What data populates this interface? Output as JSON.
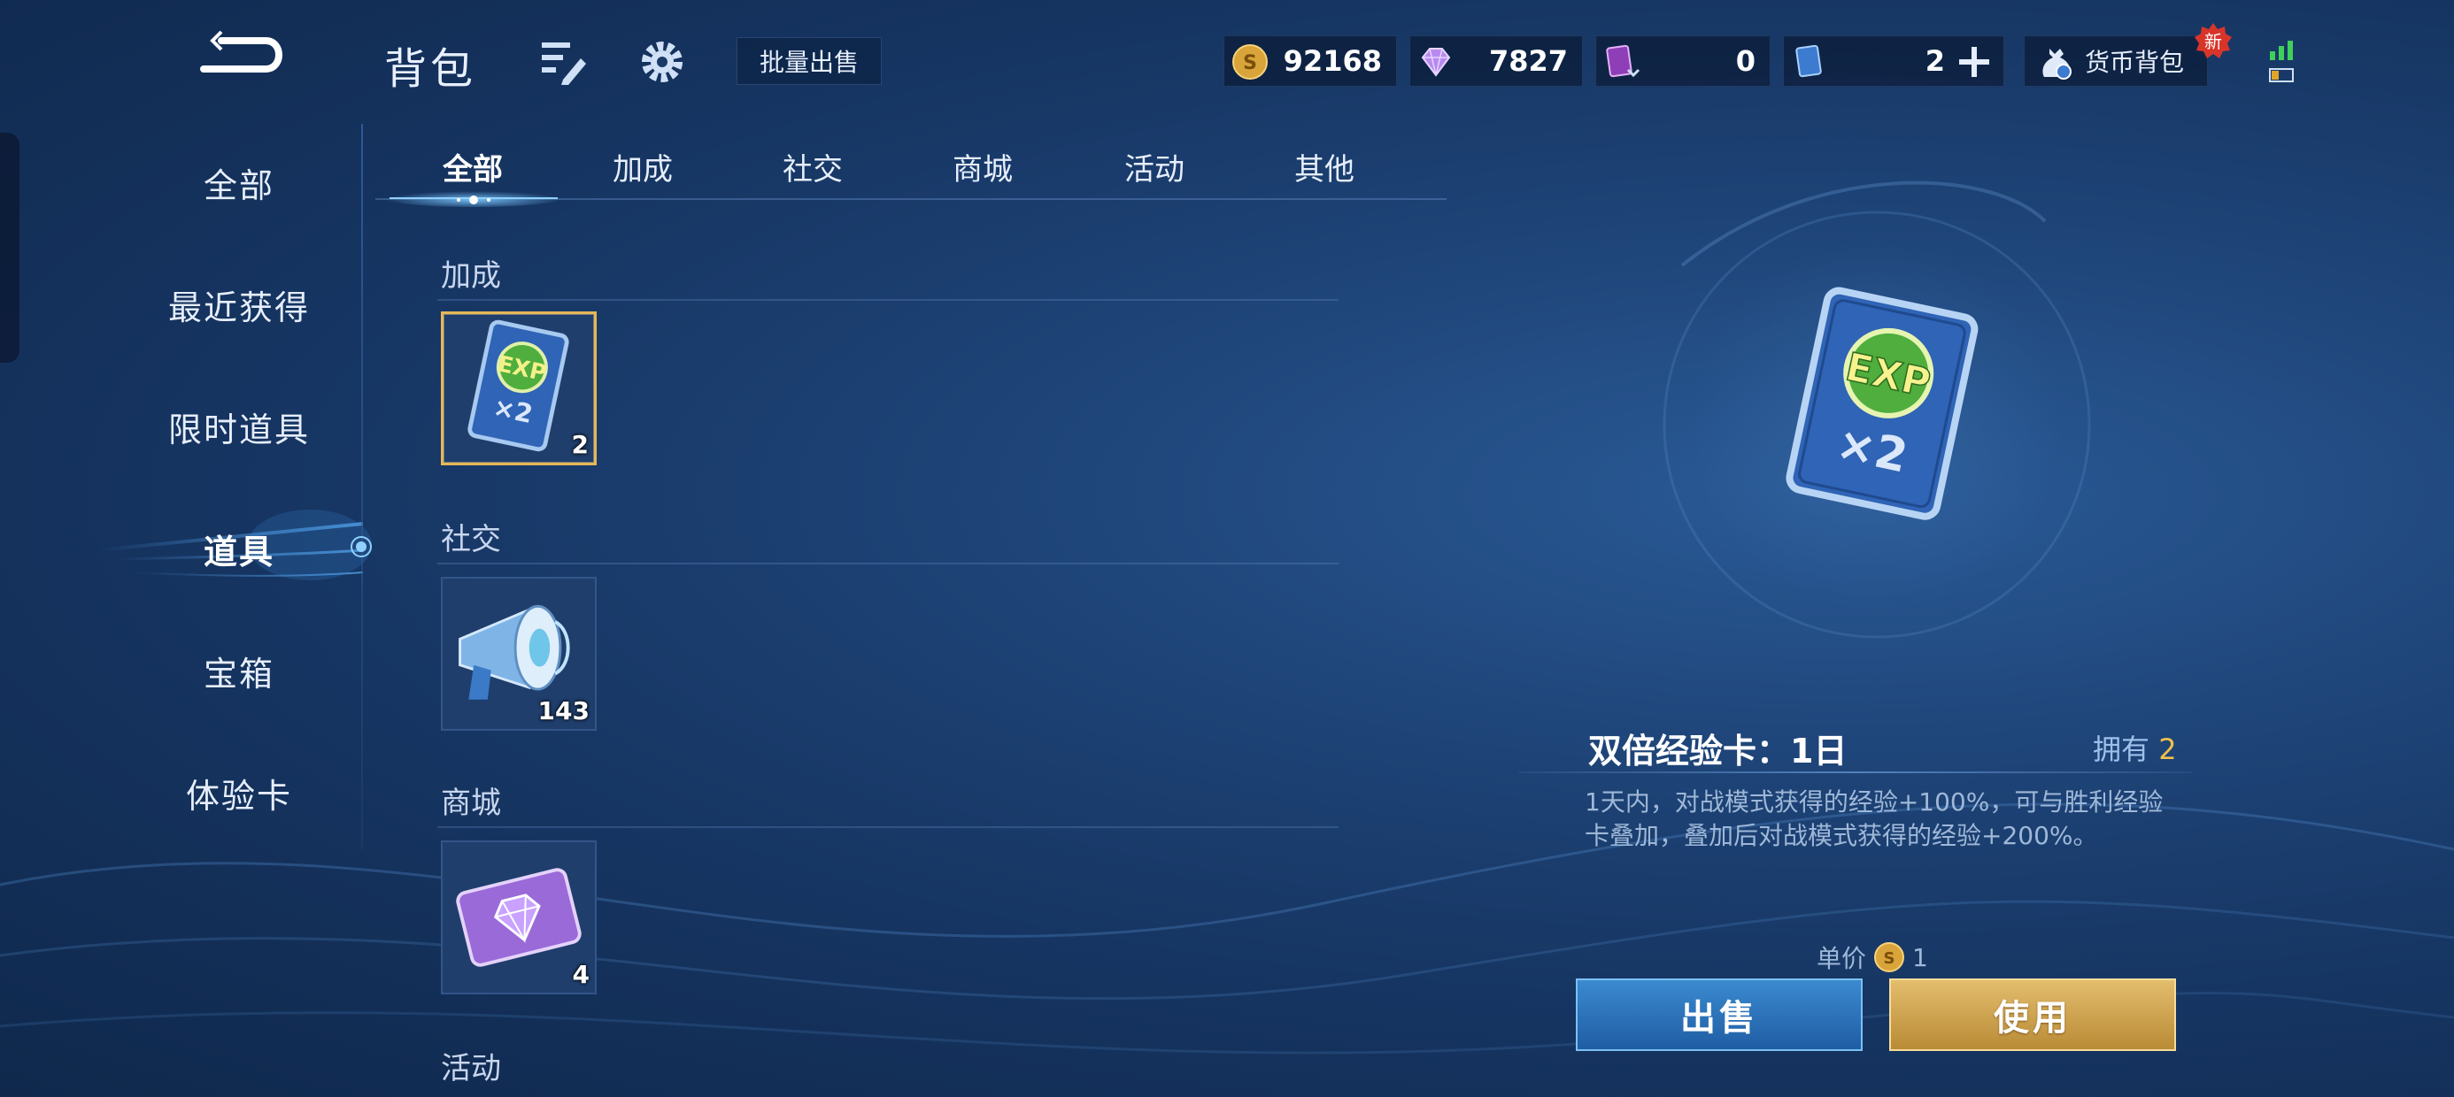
{
  "header": {
    "title": "背包",
    "batch_sell_label": "批量出售",
    "wallet_label": "货币背包",
    "new_badge": "新"
  },
  "currencies": {
    "gold": "92168",
    "gem": "7827",
    "card": "0",
    "ticket": "2"
  },
  "sidebar": {
    "items": [
      {
        "label": "全部"
      },
      {
        "label": "最近获得"
      },
      {
        "label": "限时道具"
      },
      {
        "label": "道具"
      },
      {
        "label": "宝箱"
      },
      {
        "label": "体验卡"
      }
    ],
    "active": "道具"
  },
  "tabs": [
    {
      "label": "全部"
    },
    {
      "label": "加成"
    },
    {
      "label": "社交"
    },
    {
      "label": "商城"
    },
    {
      "label": "活动"
    },
    {
      "label": "其他"
    }
  ],
  "sections": [
    {
      "title": "加成",
      "items": [
        {
          "icon": "exp-double-card-icon",
          "count": "2",
          "selected": true
        }
      ]
    },
    {
      "title": "社交",
      "items": [
        {
          "icon": "megaphone-icon",
          "count": "143"
        }
      ]
    },
    {
      "title": "商城",
      "items": [
        {
          "icon": "purple-gem-ticket-icon",
          "count": "4"
        }
      ]
    },
    {
      "title": "活动",
      "items": []
    }
  ],
  "detail": {
    "name": "双倍经验卡：1日",
    "own_label": "拥有",
    "own_count": "2",
    "description": "1天内，对战模式获得的经验+100%，可与胜利经验卡叠加，叠加后对战模式获得的经验+200%。",
    "price_label": "单价",
    "price_value": "1",
    "sell_label": "出售",
    "use_label": "使用"
  },
  "colors": {
    "accent_gold": "#e7b757",
    "accent_blue": "#3b8ad0",
    "own_count": "#f0c04a"
  }
}
